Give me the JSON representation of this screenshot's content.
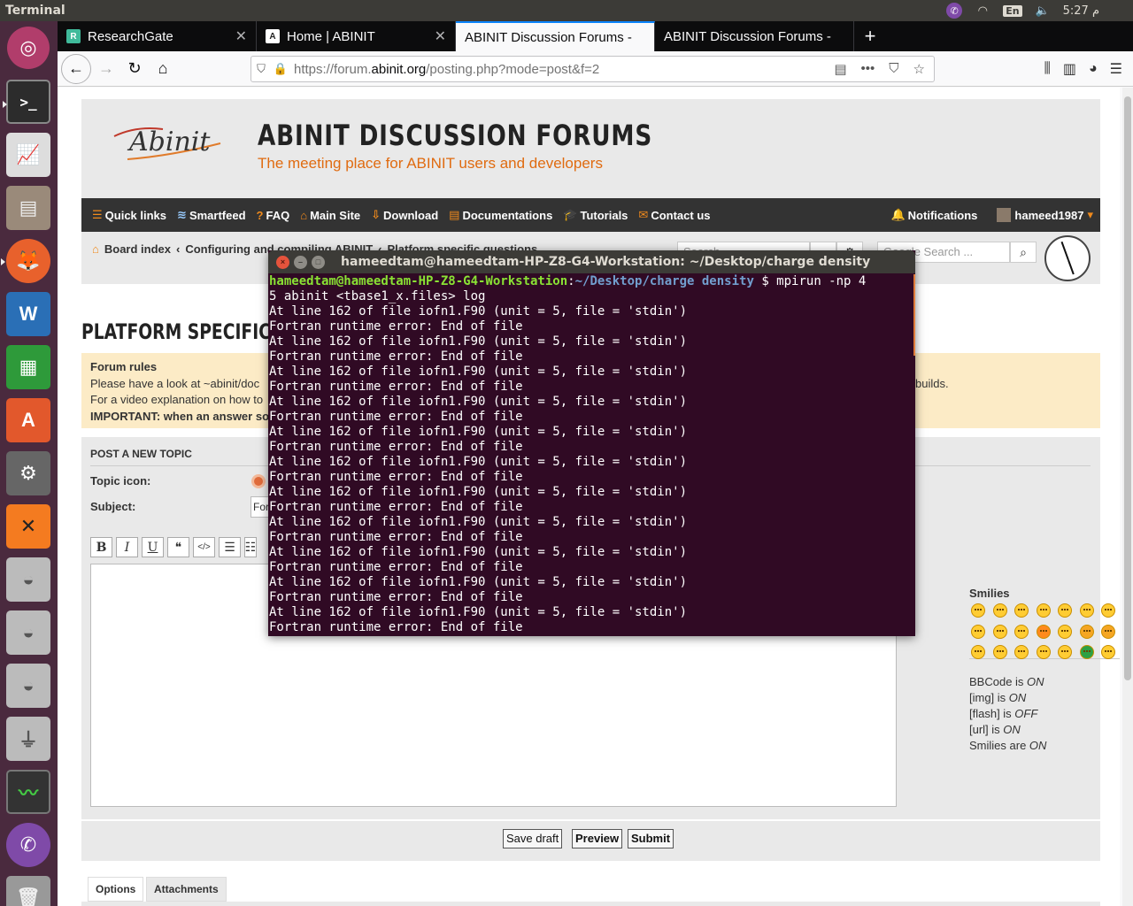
{
  "panel": {
    "app_title": "Terminal",
    "lang": "En",
    "time": "5:27 م"
  },
  "launcher": {
    "items": [
      "ubuntu-dash",
      "terminal",
      "system-monitor-app",
      "files",
      "firefox",
      "writer",
      "calc",
      "software-center",
      "settings",
      "xampp",
      "drive-1",
      "drive-2",
      "drive-3",
      "usb-drive",
      "system-monitor",
      "viber",
      "trash"
    ]
  },
  "browser": {
    "tabs": [
      {
        "label": "ResearchGate",
        "fav": "R"
      },
      {
        "label": "Home | ABINIT",
        "fav": "A"
      },
      {
        "label": "ABINIT Discussion Forums -",
        "fav": ""
      },
      {
        "label": "ABINIT Discussion Forums -",
        "fav": ""
      }
    ],
    "url_prefix": "https://forum.",
    "url_domain": "abinit.org",
    "url_suffix": "/posting.php?mode=post&f=2"
  },
  "site": {
    "logo_text": "Abinit",
    "title": "ABINIT DISCUSSION FORUMS",
    "subtitle": "The meeting place for ABINIT users and developers",
    "nav": [
      {
        "label": "Quick links",
        "icon": "☰"
      },
      {
        "label": "Smartfeed",
        "icon": "≋"
      },
      {
        "label": "FAQ",
        "icon": "?"
      },
      {
        "label": "Main Site",
        "icon": "⌂"
      },
      {
        "label": "Download",
        "icon": "⇩"
      },
      {
        "label": "Documentations",
        "icon": "▤"
      },
      {
        "label": "Tutorials",
        "icon": "🎓"
      },
      {
        "label": "Contact us",
        "icon": "✉"
      }
    ],
    "notifications": "Notifications",
    "username": "hameed1987",
    "crumbs": [
      "Board index",
      "Configuring and compiling ABINIT",
      "Platform specific questions"
    ],
    "search_placeholder": "Search…",
    "google_search_placeholder": "Google Search ...",
    "forum_heading": "PLATFORM SPECIFIC QU",
    "rules": {
      "title": "Forum rules",
      "line1": "Please have a look at ~abinit/doc",
      "line1_end": "builds.",
      "line2": "For a video explanation on how to",
      "line3": "IMPORTANT: when an answer so"
    },
    "post": {
      "title": "POST A NEW TOPIC",
      "topic_icon_label": "Topic icon:",
      "subject_label": "Subject:",
      "subject_value": "For",
      "toolbar": [
        "B",
        "I",
        "U",
        "❝",
        "</>",
        "☰",
        "☷"
      ]
    },
    "smilies_title": "Smilies",
    "bbinfo": [
      {
        "label": "BBCode is ",
        "state": "ON"
      },
      {
        "label": "[img] is ",
        "state": "ON"
      },
      {
        "label": "[flash] is ",
        "state": "OFF"
      },
      {
        "label": "[url] is ",
        "state": "ON"
      },
      {
        "label": "Smilies are ",
        "state": "ON"
      }
    ],
    "buttons": {
      "save": "Save draft",
      "preview": "Preview",
      "submit": "Submit"
    },
    "bottom_tabs": [
      "Options",
      "Attachments"
    ]
  },
  "terminal": {
    "title": "hameedtam@hameedtam-HP-Z8-G4-Workstation: ~/Desktop/charge density",
    "prompt_user": "hameedtam@hameedtam-HP-Z8-G4-Workstation",
    "prompt_path": "~/Desktop/charge density",
    "command_line1": " $ mpirun -np 4",
    "command_line2": "5 abinit <tbase1_x.files> log",
    "error_line_a": "At line 162 of file iofn1.F90 (unit = 5, file = 'stdin')",
    "error_line_b": "Fortran runtime error: End of file",
    "error_repeats": 11
  },
  "colors": {
    "accent_orange": "#f08a1c",
    "terminal_bg": "#300a24",
    "prompt_green": "#8ae234",
    "prompt_blue": "#729fcf",
    "firefox_accent": "#0a84ff"
  }
}
